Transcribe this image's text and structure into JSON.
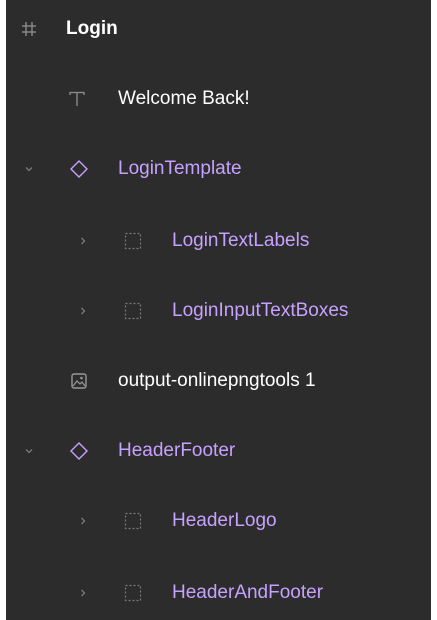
{
  "layers": [
    {
      "name": "Login",
      "icon": "frame-hash-icon",
      "expanded": null
    },
    {
      "name": "Welcome Back!",
      "icon": "text-icon",
      "expanded": null
    },
    {
      "name": "LoginTemplate",
      "icon": "component-diamond-icon",
      "expanded": true
    },
    {
      "name": "LoginTextLabels",
      "icon": "dashed-frame-icon",
      "expanded": false
    },
    {
      "name": "LoginInputTextBoxes",
      "icon": "dashed-frame-icon",
      "expanded": false
    },
    {
      "name": "output-onlinepngtools 1",
      "icon": "image-icon",
      "expanded": null
    },
    {
      "name": "HeaderFooter",
      "icon": "component-diamond-icon",
      "expanded": true
    },
    {
      "name": "HeaderLogo",
      "icon": "dashed-frame-icon",
      "expanded": false
    },
    {
      "name": "HeaderAndFooter",
      "icon": "dashed-frame-icon",
      "expanded": false
    }
  ],
  "colors": {
    "panel_bg": "#2c2c2c",
    "text_primary": "#ffffff",
    "text_component": "#c7a1ff",
    "icon_muted": "#7a7a7a"
  }
}
